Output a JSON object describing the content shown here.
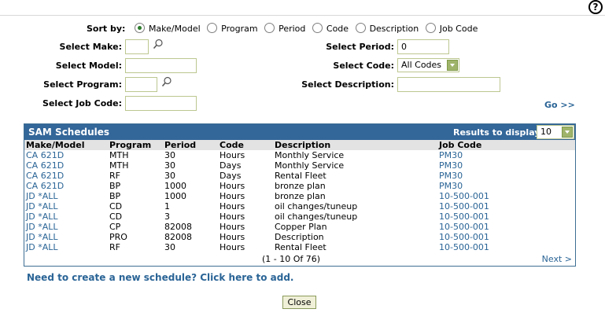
{
  "help": {
    "icon": "help-icon",
    "glyph": "?"
  },
  "sort": {
    "label": "Sort by:",
    "options": [
      "Make/Model",
      "Program",
      "Period",
      "Code",
      "Description",
      "Job Code"
    ],
    "selected": "Make/Model"
  },
  "filters": {
    "make_label": "Select Make:",
    "make_value": "",
    "model_label": "Select Model:",
    "model_value": "",
    "program_label": "Select Program:",
    "program_value": "",
    "jobcode_label": "Select Job Code:",
    "jobcode_value": "",
    "period_label": "Select Period:",
    "period_value": "0",
    "code_label": "Select Code:",
    "code_value": "All Codes",
    "description_label": "Select Description:",
    "description_value": "",
    "go_label": "Go >>"
  },
  "panel": {
    "title": "SAM Schedules",
    "results_label": "Results to display:",
    "results_value": "10",
    "columns": [
      "Make/Model",
      "Program",
      "Period",
      "Code",
      "Description",
      "Job Code"
    ],
    "rows": [
      [
        "CA 621D",
        "MTH",
        "30",
        "Hours",
        "Monthly Service",
        "PM30"
      ],
      [
        "CA 621D",
        "MTH",
        "30",
        "Days",
        "Monthly Service",
        "PM30"
      ],
      [
        "CA 621D",
        "RF",
        "30",
        "Days",
        "Rental Fleet",
        "PM30"
      ],
      [
        "CA 621D",
        "BP",
        "1000",
        "Hours",
        "bronze plan",
        "PM30"
      ],
      [
        "JD *ALL",
        "BP",
        "1000",
        "Hours",
        "bronze plan",
        "10-500-001"
      ],
      [
        "JD *ALL",
        "CD",
        "1",
        "Hours",
        "oil changes/tuneup",
        "10-500-001"
      ],
      [
        "JD *ALL",
        "CD",
        "3",
        "Hours",
        "oil changes/tuneup",
        "10-500-001"
      ],
      [
        "JD *ALL",
        "CP",
        "82008",
        "Hours",
        "Copper Plan",
        "10-500-001"
      ],
      [
        "JD *ALL",
        "PRO",
        "82008",
        "Hours",
        "Description",
        "10-500-001"
      ],
      [
        "JD *ALL",
        "RF",
        "30",
        "Hours",
        "Rental Fleet",
        "10-500-001"
      ]
    ],
    "pager_text": "(1 - 10 Of 76)",
    "next_label": "Next >"
  },
  "add_link": "Need to create a new schedule? Click here to add.",
  "close_label": "Close",
  "colors": {
    "header_blue": "#336699",
    "link_blue": "#2a6496",
    "input_border": "#bcc790"
  }
}
